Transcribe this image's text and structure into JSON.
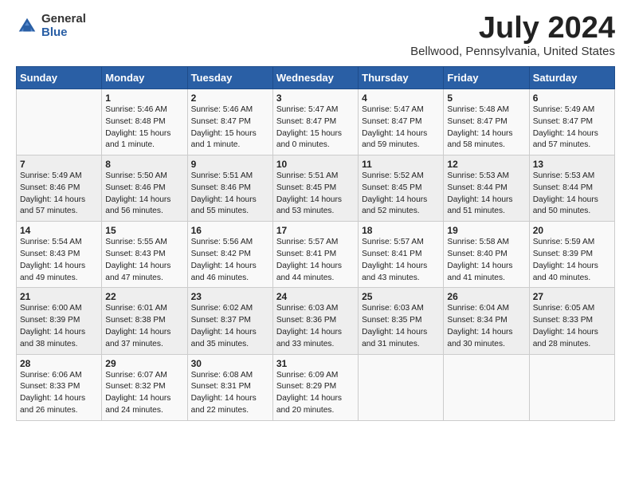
{
  "header": {
    "logo_general": "General",
    "logo_blue": "Blue",
    "month_title": "July 2024",
    "location": "Bellwood, Pennsylvania, United States"
  },
  "days_of_week": [
    "Sunday",
    "Monday",
    "Tuesday",
    "Wednesday",
    "Thursday",
    "Friday",
    "Saturday"
  ],
  "weeks": [
    [
      {
        "day": "",
        "sunrise": "",
        "sunset": "",
        "daylight": ""
      },
      {
        "day": "1",
        "sunrise": "Sunrise: 5:46 AM",
        "sunset": "Sunset: 8:48 PM",
        "daylight": "Daylight: 15 hours and 1 minute."
      },
      {
        "day": "2",
        "sunrise": "Sunrise: 5:46 AM",
        "sunset": "Sunset: 8:47 PM",
        "daylight": "Daylight: 15 hours and 1 minute."
      },
      {
        "day": "3",
        "sunrise": "Sunrise: 5:47 AM",
        "sunset": "Sunset: 8:47 PM",
        "daylight": "Daylight: 15 hours and 0 minutes."
      },
      {
        "day": "4",
        "sunrise": "Sunrise: 5:47 AM",
        "sunset": "Sunset: 8:47 PM",
        "daylight": "Daylight: 14 hours and 59 minutes."
      },
      {
        "day": "5",
        "sunrise": "Sunrise: 5:48 AM",
        "sunset": "Sunset: 8:47 PM",
        "daylight": "Daylight: 14 hours and 58 minutes."
      },
      {
        "day": "6",
        "sunrise": "Sunrise: 5:49 AM",
        "sunset": "Sunset: 8:47 PM",
        "daylight": "Daylight: 14 hours and 57 minutes."
      }
    ],
    [
      {
        "day": "7",
        "sunrise": "Sunrise: 5:49 AM",
        "sunset": "Sunset: 8:46 PM",
        "daylight": "Daylight: 14 hours and 57 minutes."
      },
      {
        "day": "8",
        "sunrise": "Sunrise: 5:50 AM",
        "sunset": "Sunset: 8:46 PM",
        "daylight": "Daylight: 14 hours and 56 minutes."
      },
      {
        "day": "9",
        "sunrise": "Sunrise: 5:51 AM",
        "sunset": "Sunset: 8:46 PM",
        "daylight": "Daylight: 14 hours and 55 minutes."
      },
      {
        "day": "10",
        "sunrise": "Sunrise: 5:51 AM",
        "sunset": "Sunset: 8:45 PM",
        "daylight": "Daylight: 14 hours and 53 minutes."
      },
      {
        "day": "11",
        "sunrise": "Sunrise: 5:52 AM",
        "sunset": "Sunset: 8:45 PM",
        "daylight": "Daylight: 14 hours and 52 minutes."
      },
      {
        "day": "12",
        "sunrise": "Sunrise: 5:53 AM",
        "sunset": "Sunset: 8:44 PM",
        "daylight": "Daylight: 14 hours and 51 minutes."
      },
      {
        "day": "13",
        "sunrise": "Sunrise: 5:53 AM",
        "sunset": "Sunset: 8:44 PM",
        "daylight": "Daylight: 14 hours and 50 minutes."
      }
    ],
    [
      {
        "day": "14",
        "sunrise": "Sunrise: 5:54 AM",
        "sunset": "Sunset: 8:43 PM",
        "daylight": "Daylight: 14 hours and 49 minutes."
      },
      {
        "day": "15",
        "sunrise": "Sunrise: 5:55 AM",
        "sunset": "Sunset: 8:43 PM",
        "daylight": "Daylight: 14 hours and 47 minutes."
      },
      {
        "day": "16",
        "sunrise": "Sunrise: 5:56 AM",
        "sunset": "Sunset: 8:42 PM",
        "daylight": "Daylight: 14 hours and 46 minutes."
      },
      {
        "day": "17",
        "sunrise": "Sunrise: 5:57 AM",
        "sunset": "Sunset: 8:41 PM",
        "daylight": "Daylight: 14 hours and 44 minutes."
      },
      {
        "day": "18",
        "sunrise": "Sunrise: 5:57 AM",
        "sunset": "Sunset: 8:41 PM",
        "daylight": "Daylight: 14 hours and 43 minutes."
      },
      {
        "day": "19",
        "sunrise": "Sunrise: 5:58 AM",
        "sunset": "Sunset: 8:40 PM",
        "daylight": "Daylight: 14 hours and 41 minutes."
      },
      {
        "day": "20",
        "sunrise": "Sunrise: 5:59 AM",
        "sunset": "Sunset: 8:39 PM",
        "daylight": "Daylight: 14 hours and 40 minutes."
      }
    ],
    [
      {
        "day": "21",
        "sunrise": "Sunrise: 6:00 AM",
        "sunset": "Sunset: 8:39 PM",
        "daylight": "Daylight: 14 hours and 38 minutes."
      },
      {
        "day": "22",
        "sunrise": "Sunrise: 6:01 AM",
        "sunset": "Sunset: 8:38 PM",
        "daylight": "Daylight: 14 hours and 37 minutes."
      },
      {
        "day": "23",
        "sunrise": "Sunrise: 6:02 AM",
        "sunset": "Sunset: 8:37 PM",
        "daylight": "Daylight: 14 hours and 35 minutes."
      },
      {
        "day": "24",
        "sunrise": "Sunrise: 6:03 AM",
        "sunset": "Sunset: 8:36 PM",
        "daylight": "Daylight: 14 hours and 33 minutes."
      },
      {
        "day": "25",
        "sunrise": "Sunrise: 6:03 AM",
        "sunset": "Sunset: 8:35 PM",
        "daylight": "Daylight: 14 hours and 31 minutes."
      },
      {
        "day": "26",
        "sunrise": "Sunrise: 6:04 AM",
        "sunset": "Sunset: 8:34 PM",
        "daylight": "Daylight: 14 hours and 30 minutes."
      },
      {
        "day": "27",
        "sunrise": "Sunrise: 6:05 AM",
        "sunset": "Sunset: 8:33 PM",
        "daylight": "Daylight: 14 hours and 28 minutes."
      }
    ],
    [
      {
        "day": "28",
        "sunrise": "Sunrise: 6:06 AM",
        "sunset": "Sunset: 8:33 PM",
        "daylight": "Daylight: 14 hours and 26 minutes."
      },
      {
        "day": "29",
        "sunrise": "Sunrise: 6:07 AM",
        "sunset": "Sunset: 8:32 PM",
        "daylight": "Daylight: 14 hours and 24 minutes."
      },
      {
        "day": "30",
        "sunrise": "Sunrise: 6:08 AM",
        "sunset": "Sunset: 8:31 PM",
        "daylight": "Daylight: 14 hours and 22 minutes."
      },
      {
        "day": "31",
        "sunrise": "Sunrise: 6:09 AM",
        "sunset": "Sunset: 8:29 PM",
        "daylight": "Daylight: 14 hours and 20 minutes."
      },
      {
        "day": "",
        "sunrise": "",
        "sunset": "",
        "daylight": ""
      },
      {
        "day": "",
        "sunrise": "",
        "sunset": "",
        "daylight": ""
      },
      {
        "day": "",
        "sunrise": "",
        "sunset": "",
        "daylight": ""
      }
    ]
  ]
}
